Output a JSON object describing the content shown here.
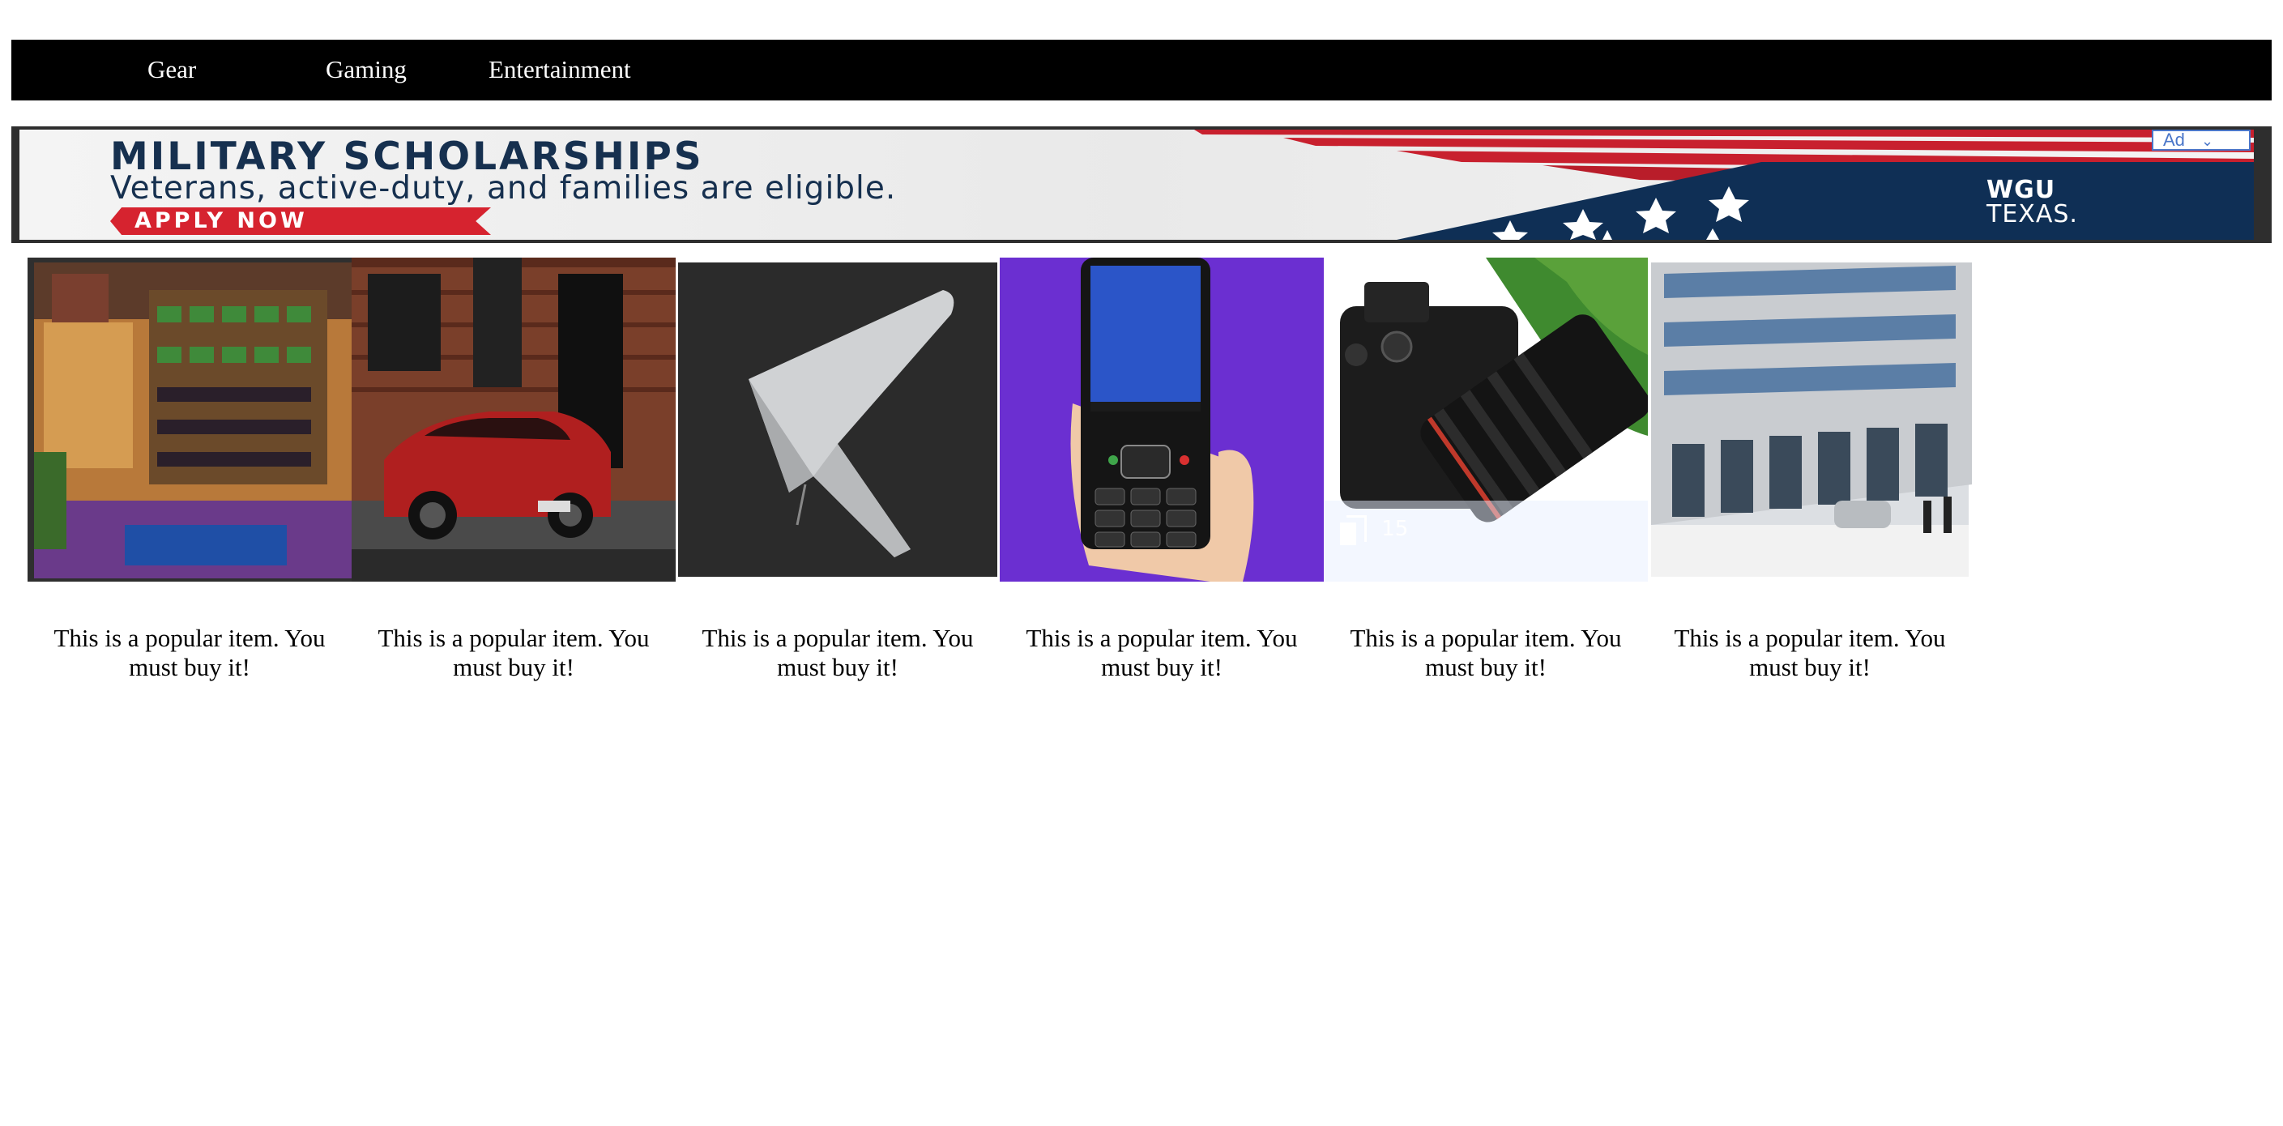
{
  "nav": {
    "items": [
      {
        "label": "Gear"
      },
      {
        "label": "Gaming"
      },
      {
        "label": "Entertainment"
      }
    ],
    "background": "#000000",
    "text_color": "#ffffff"
  },
  "ad": {
    "headline": "MILITARY SCHOLARSHIPS",
    "subline": "Veterans, active-duty, and families are eligible.",
    "cta": "APPLY NOW",
    "brand_top": "WGU",
    "brand_bottom": "TEXAS.",
    "badge": "Ad",
    "colors": {
      "navy": "#0f2f55",
      "red": "#d6232f",
      "text": "#16304f"
    }
  },
  "products": [
    {
      "image": "farm-game-screenshot",
      "caption": "This is a popular item. You must buy it!"
    },
    {
      "image": "red-sedan-car",
      "caption": "This is a popular item. You must buy it!"
    },
    {
      "image": "delta-wing-drone",
      "caption": "This is a popular item. You must buy it!"
    },
    {
      "image": "feature-phone-in-hand",
      "caption": "This is a popular item. You must buy it!"
    },
    {
      "image": "mirrorless-camera",
      "caption": "This is a popular item. You must buy it!",
      "photo_count": "15"
    },
    {
      "image": "office-building-snow",
      "caption": "This is a popular item. You must buy it!"
    }
  ]
}
